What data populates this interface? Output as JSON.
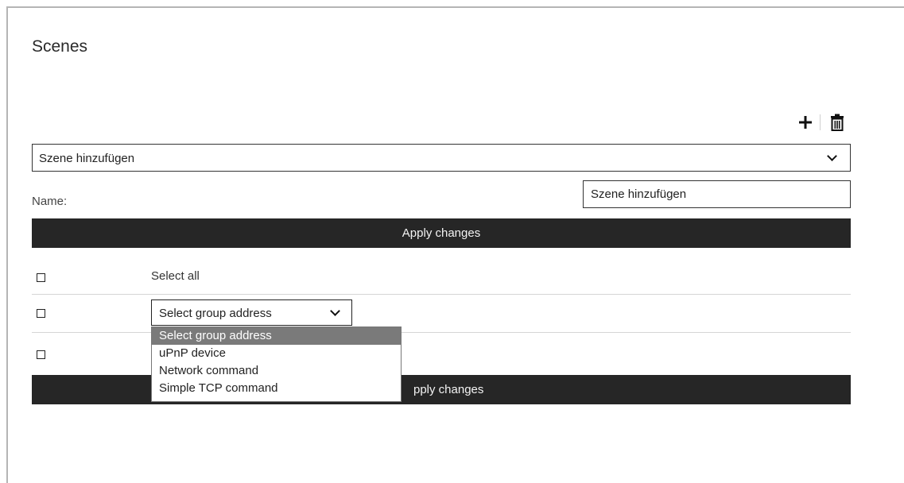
{
  "page": {
    "title": "Scenes"
  },
  "toolbar": {
    "add_icon": "plus-icon",
    "delete_icon": "trash-icon"
  },
  "scene_select": {
    "value": "Szene hinzufügen"
  },
  "name_field": {
    "label": "Name:",
    "value": "Szene hinzufügen"
  },
  "apply_top": {
    "label": "Apply changes"
  },
  "apply_bottom": {
    "label": "pply changes"
  },
  "rows": {
    "select_all_label": "Select all"
  },
  "group_select": {
    "value": "Select group address",
    "options": [
      "Select group address",
      "uPnP device",
      "Network command",
      "Simple TCP command"
    ],
    "highlighted_index": 0
  },
  "colors": {
    "bar_background": "#262626",
    "highlight": "#7a7a7a"
  }
}
